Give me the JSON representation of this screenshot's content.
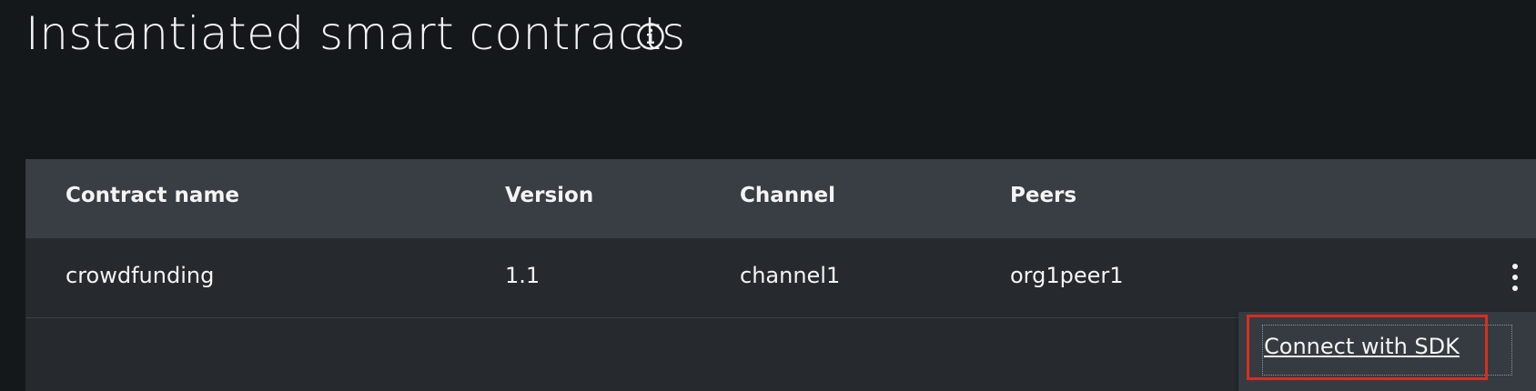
{
  "header": {
    "title": "Instantiated smart contracts",
    "info_icon": "info-circle-icon"
  },
  "table": {
    "columns": [
      "Contract name",
      "Version",
      "Channel",
      "Peers"
    ],
    "rows": [
      {
        "name": "crowdfunding",
        "version": "1.1",
        "channel": "channel1",
        "peers": "org1peer1"
      }
    ],
    "row_action_icon": "overflow-menu-vertical-icon"
  },
  "overflow_menu": {
    "items": [
      {
        "label": "Connect with SDK"
      }
    ]
  },
  "colors": {
    "background": "#15181b",
    "table_header": "#393e44",
    "table_row": "#262a2e",
    "menu": "#353b41",
    "highlight": "#d72d21",
    "text": "#f4f4f4"
  }
}
